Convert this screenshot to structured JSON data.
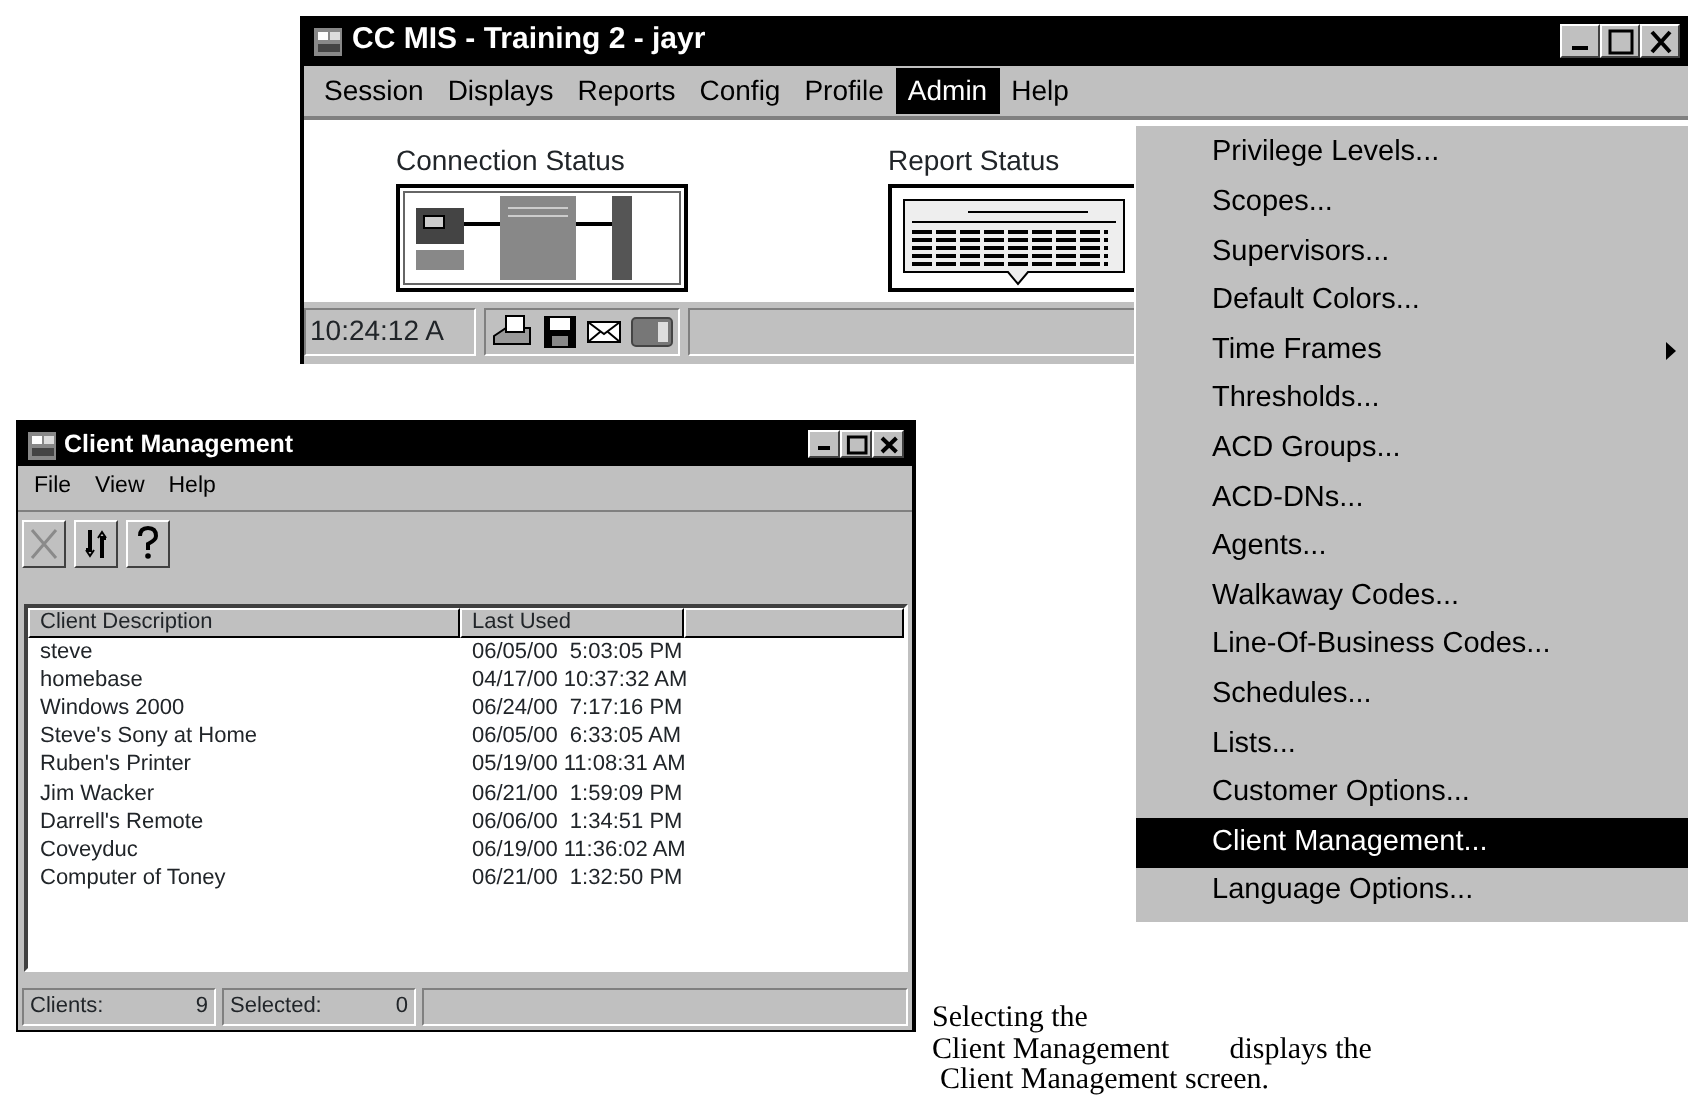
{
  "main_window": {
    "title": "CC MIS - Training 2 - jayr",
    "menu": [
      {
        "label": "Session",
        "selected": false
      },
      {
        "label": "Displays",
        "selected": false
      },
      {
        "label": "Reports",
        "selected": false
      },
      {
        "label": "Config",
        "selected": false
      },
      {
        "label": "Profile",
        "selected": false
      },
      {
        "label": "Admin",
        "selected": true
      },
      {
        "label": "Help",
        "selected": false
      }
    ],
    "panels": [
      {
        "label": "Connection Status",
        "kind": "connection"
      },
      {
        "label": "Report Status",
        "kind": "report"
      }
    ],
    "status_bar": {
      "time": "10:24:12 A"
    }
  },
  "admin_menu": [
    {
      "label": "Privilege Levels...",
      "kind": "item",
      "selected": false
    },
    {
      "label": "Scopes...",
      "kind": "item",
      "selected": false
    },
    {
      "label": "Supervisors...",
      "kind": "item",
      "selected": false
    },
    {
      "label": "Default Colors...",
      "kind": "item",
      "selected": false
    },
    {
      "label": "Time Frames",
      "kind": "submenu",
      "selected": false
    },
    {
      "label": "Thresholds...",
      "kind": "item",
      "selected": false
    },
    {
      "label": "ACD Groups...",
      "kind": "item",
      "selected": false
    },
    {
      "label": "ACD-DNs...",
      "kind": "item",
      "selected": false
    },
    {
      "label": "Agents...",
      "kind": "item",
      "selected": false
    },
    {
      "label": "Walkaway Codes...",
      "kind": "item",
      "selected": false
    },
    {
      "label": "Line-Of-Business Codes...",
      "kind": "item",
      "selected": false
    },
    {
      "label": "Schedules...",
      "kind": "item",
      "selected": false
    },
    {
      "label": "Lists...",
      "kind": "item",
      "selected": false
    },
    {
      "label": "Customer Options...",
      "kind": "item",
      "selected": false
    },
    {
      "label": "Client Management...",
      "kind": "item",
      "selected": true
    },
    {
      "label": "Language Options...",
      "kind": "item",
      "selected": false
    }
  ],
  "client_window": {
    "title": "Client Management",
    "menu": [
      "File",
      "View",
      "Help"
    ],
    "toolbar": [
      {
        "kind": "delete",
        "disabled": true
      },
      {
        "kind": "refresh",
        "disabled": false
      },
      {
        "kind": "help",
        "disabled": false
      }
    ],
    "columns": [
      "Client Description",
      "Last Used"
    ],
    "rows": [
      [
        "steve",
        "06/05/00  5:03:05 PM"
      ],
      [
        "homebase",
        "04/17/00 10:37:32 AM"
      ],
      [
        "Windows 2000",
        "06/24/00  7:17:16 PM"
      ],
      [
        "Steve's Sony at Home",
        "06/05/00  6:33:05 AM"
      ],
      [
        "Ruben's Printer",
        "05/19/00 11:08:31 AM"
      ],
      [
        "Jim Wacker",
        "06/21/00  1:59:09 PM"
      ],
      [
        "Darrell's Remote",
        "06/06/00  1:34:51 PM"
      ],
      [
        "Coveyduc",
        "06/19/00 11:36:02 AM"
      ],
      [
        "Computer of Toney",
        "06/21/00  1:32:50 PM"
      ]
    ],
    "status": {
      "clients_label": "Clients:",
      "clients": "9",
      "selected_label": "Selected:",
      "selected": "0"
    }
  },
  "caption": [
    "Selecting the",
    "Client Management",
    "displays the",
    "Client Management screen."
  ]
}
